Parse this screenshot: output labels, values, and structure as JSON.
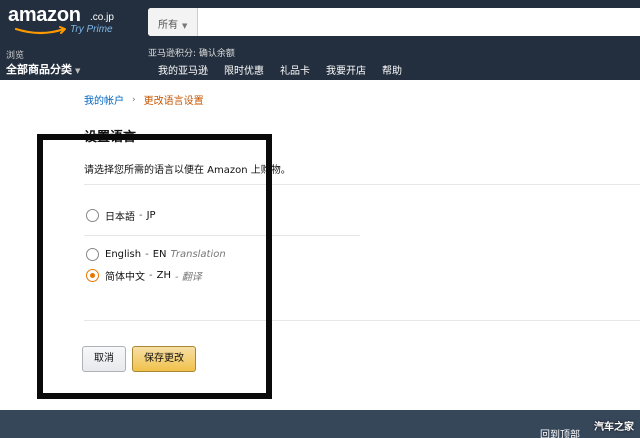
{
  "header": {
    "logo_text": "amazon",
    "logo_tld": ".co.jp",
    "logo_subtext": "Try Prime",
    "search": {
      "category": "所有",
      "placeholder": ""
    },
    "browse_label": "浏览",
    "all_categories": "全部商品分类",
    "points_text": "亚马逊积分: 确认余额",
    "nav": [
      "我的亚马逊",
      "限时优惠",
      "礼品卡",
      "我要开店",
      "帮助"
    ]
  },
  "breadcrumb": {
    "account": "我的帐户",
    "separator": "›",
    "current": "更改语言设置"
  },
  "main": {
    "title": "设置语言",
    "description": "请选择您所需的语言以便在 Amazon 上购物。",
    "languages": [
      {
        "name": "日本語",
        "sep": "-",
        "code": "JP",
        "translation": "",
        "checked": false
      },
      {
        "name": "English",
        "sep": "-",
        "code": "EN",
        "translation": "Translation",
        "checked": false
      },
      {
        "name": "简体中文",
        "sep": "-",
        "code": "ZH",
        "translation": "- 翻译",
        "checked": true
      }
    ],
    "cancel_label": "取消",
    "save_label": "保存更改"
  },
  "footer": {
    "back_to_top": "回到顶部",
    "watermark": "汽车之家"
  },
  "colors": {
    "header_bg": "#232f3e",
    "footer_bg": "#37475a",
    "link": "#0066c0",
    "breadcrumb_current": "#c45500",
    "radio_accent": "#e77600",
    "save_button": "#f0c14b",
    "highlight_frame": "#0a0a0a"
  }
}
